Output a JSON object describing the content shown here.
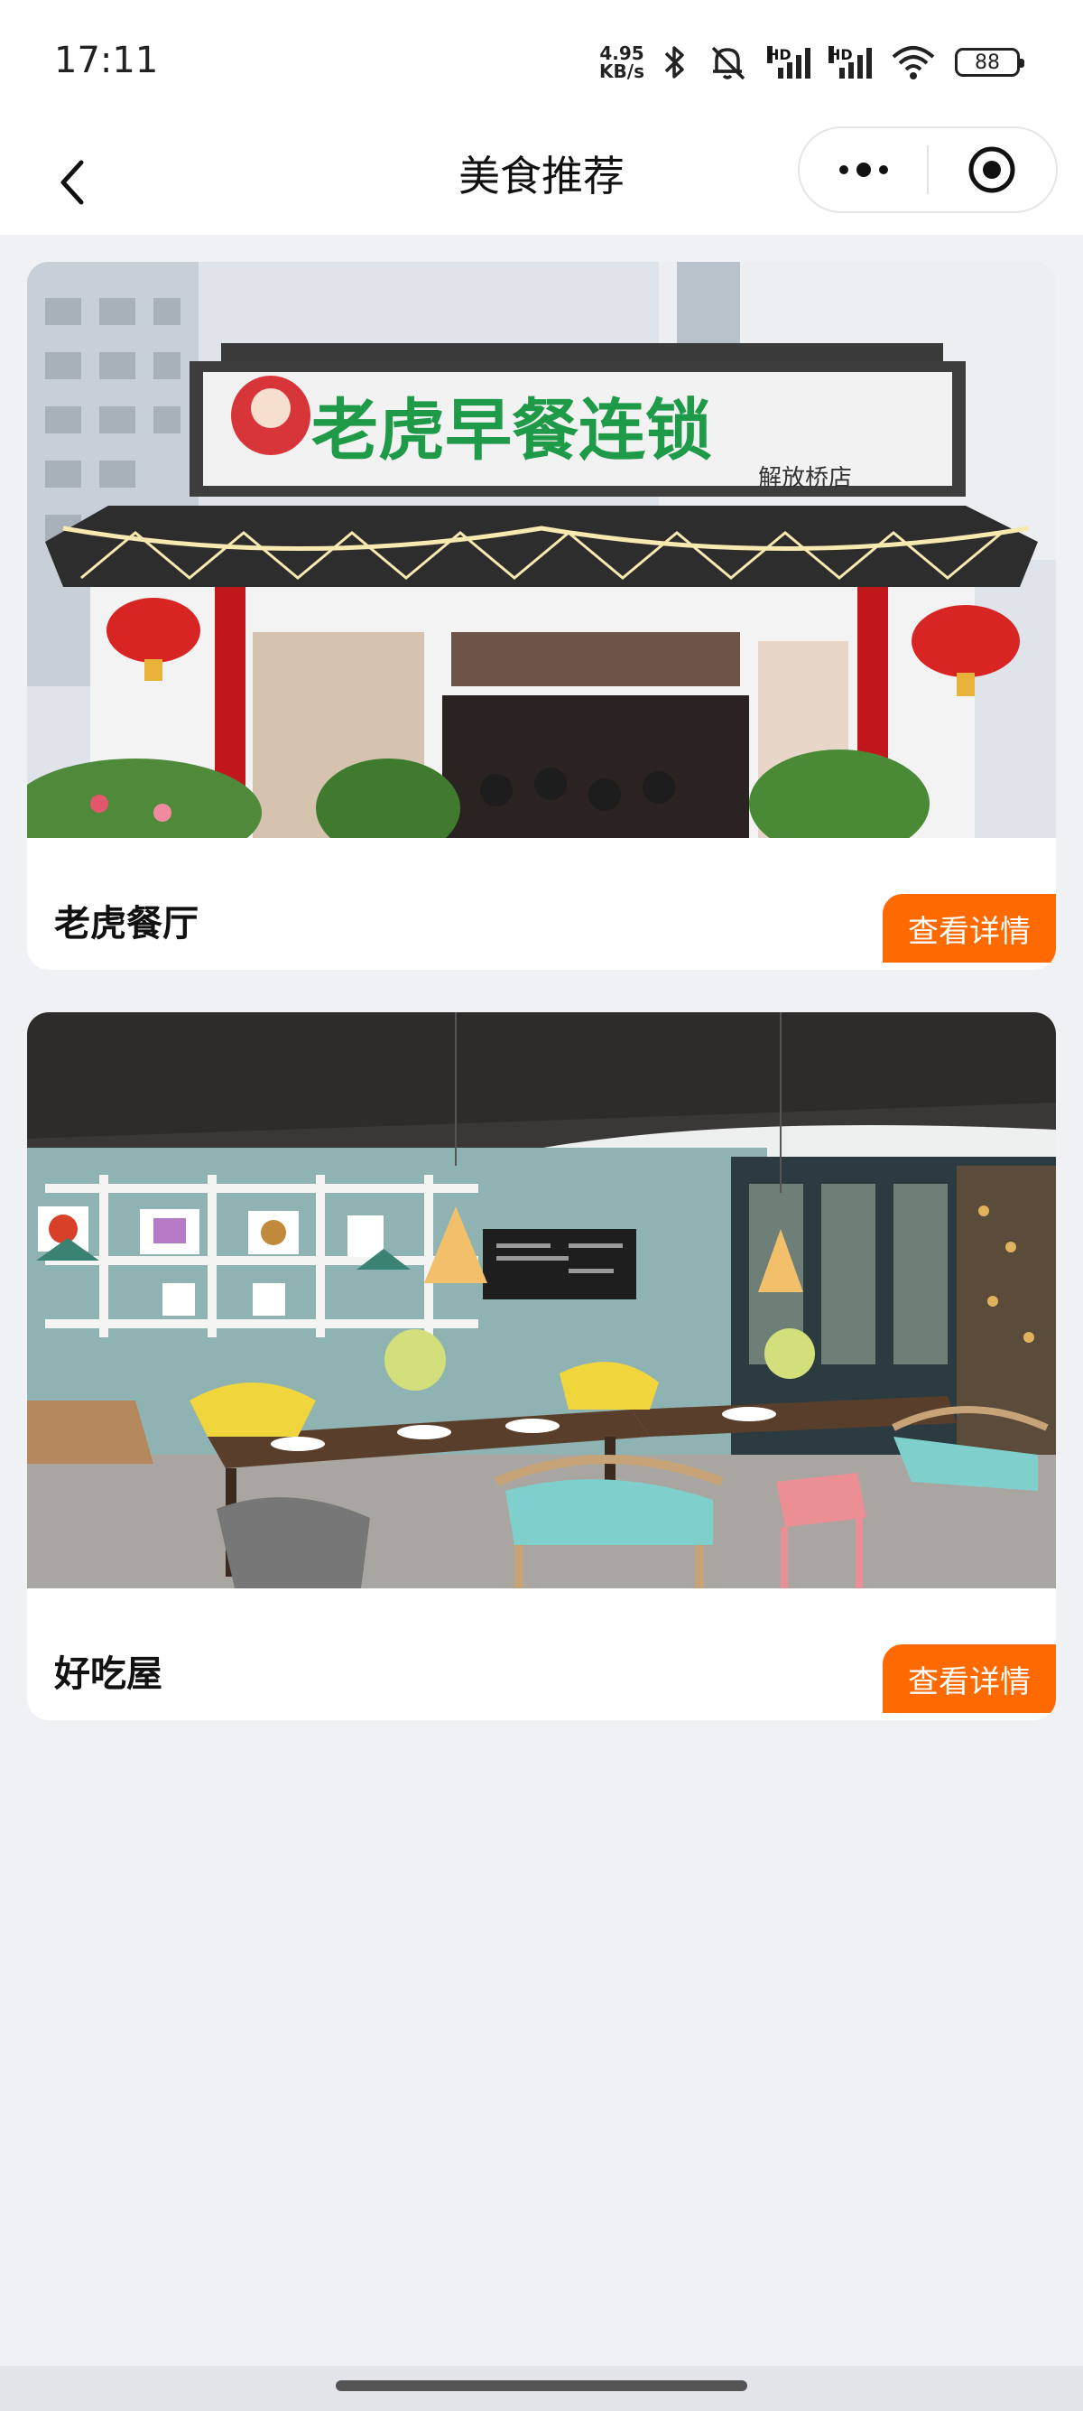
{
  "status_bar": {
    "time": "17:11",
    "net_speed_value": "4.95",
    "net_speed_unit": "KB/s",
    "signal1_label": "HD",
    "signal2_label": "HD",
    "battery": "88"
  },
  "nav": {
    "title": "美食推荐"
  },
  "restaurants": [
    {
      "name": "老虎餐厅",
      "detail_label": "查看详情",
      "sign_text": "老虎早餐连锁",
      "branch_text": "解放桥店"
    },
    {
      "name": "好吃屋",
      "detail_label": "查看详情"
    }
  ],
  "colors": {
    "accent": "#ff6a00",
    "background": "#f0f1f5"
  }
}
